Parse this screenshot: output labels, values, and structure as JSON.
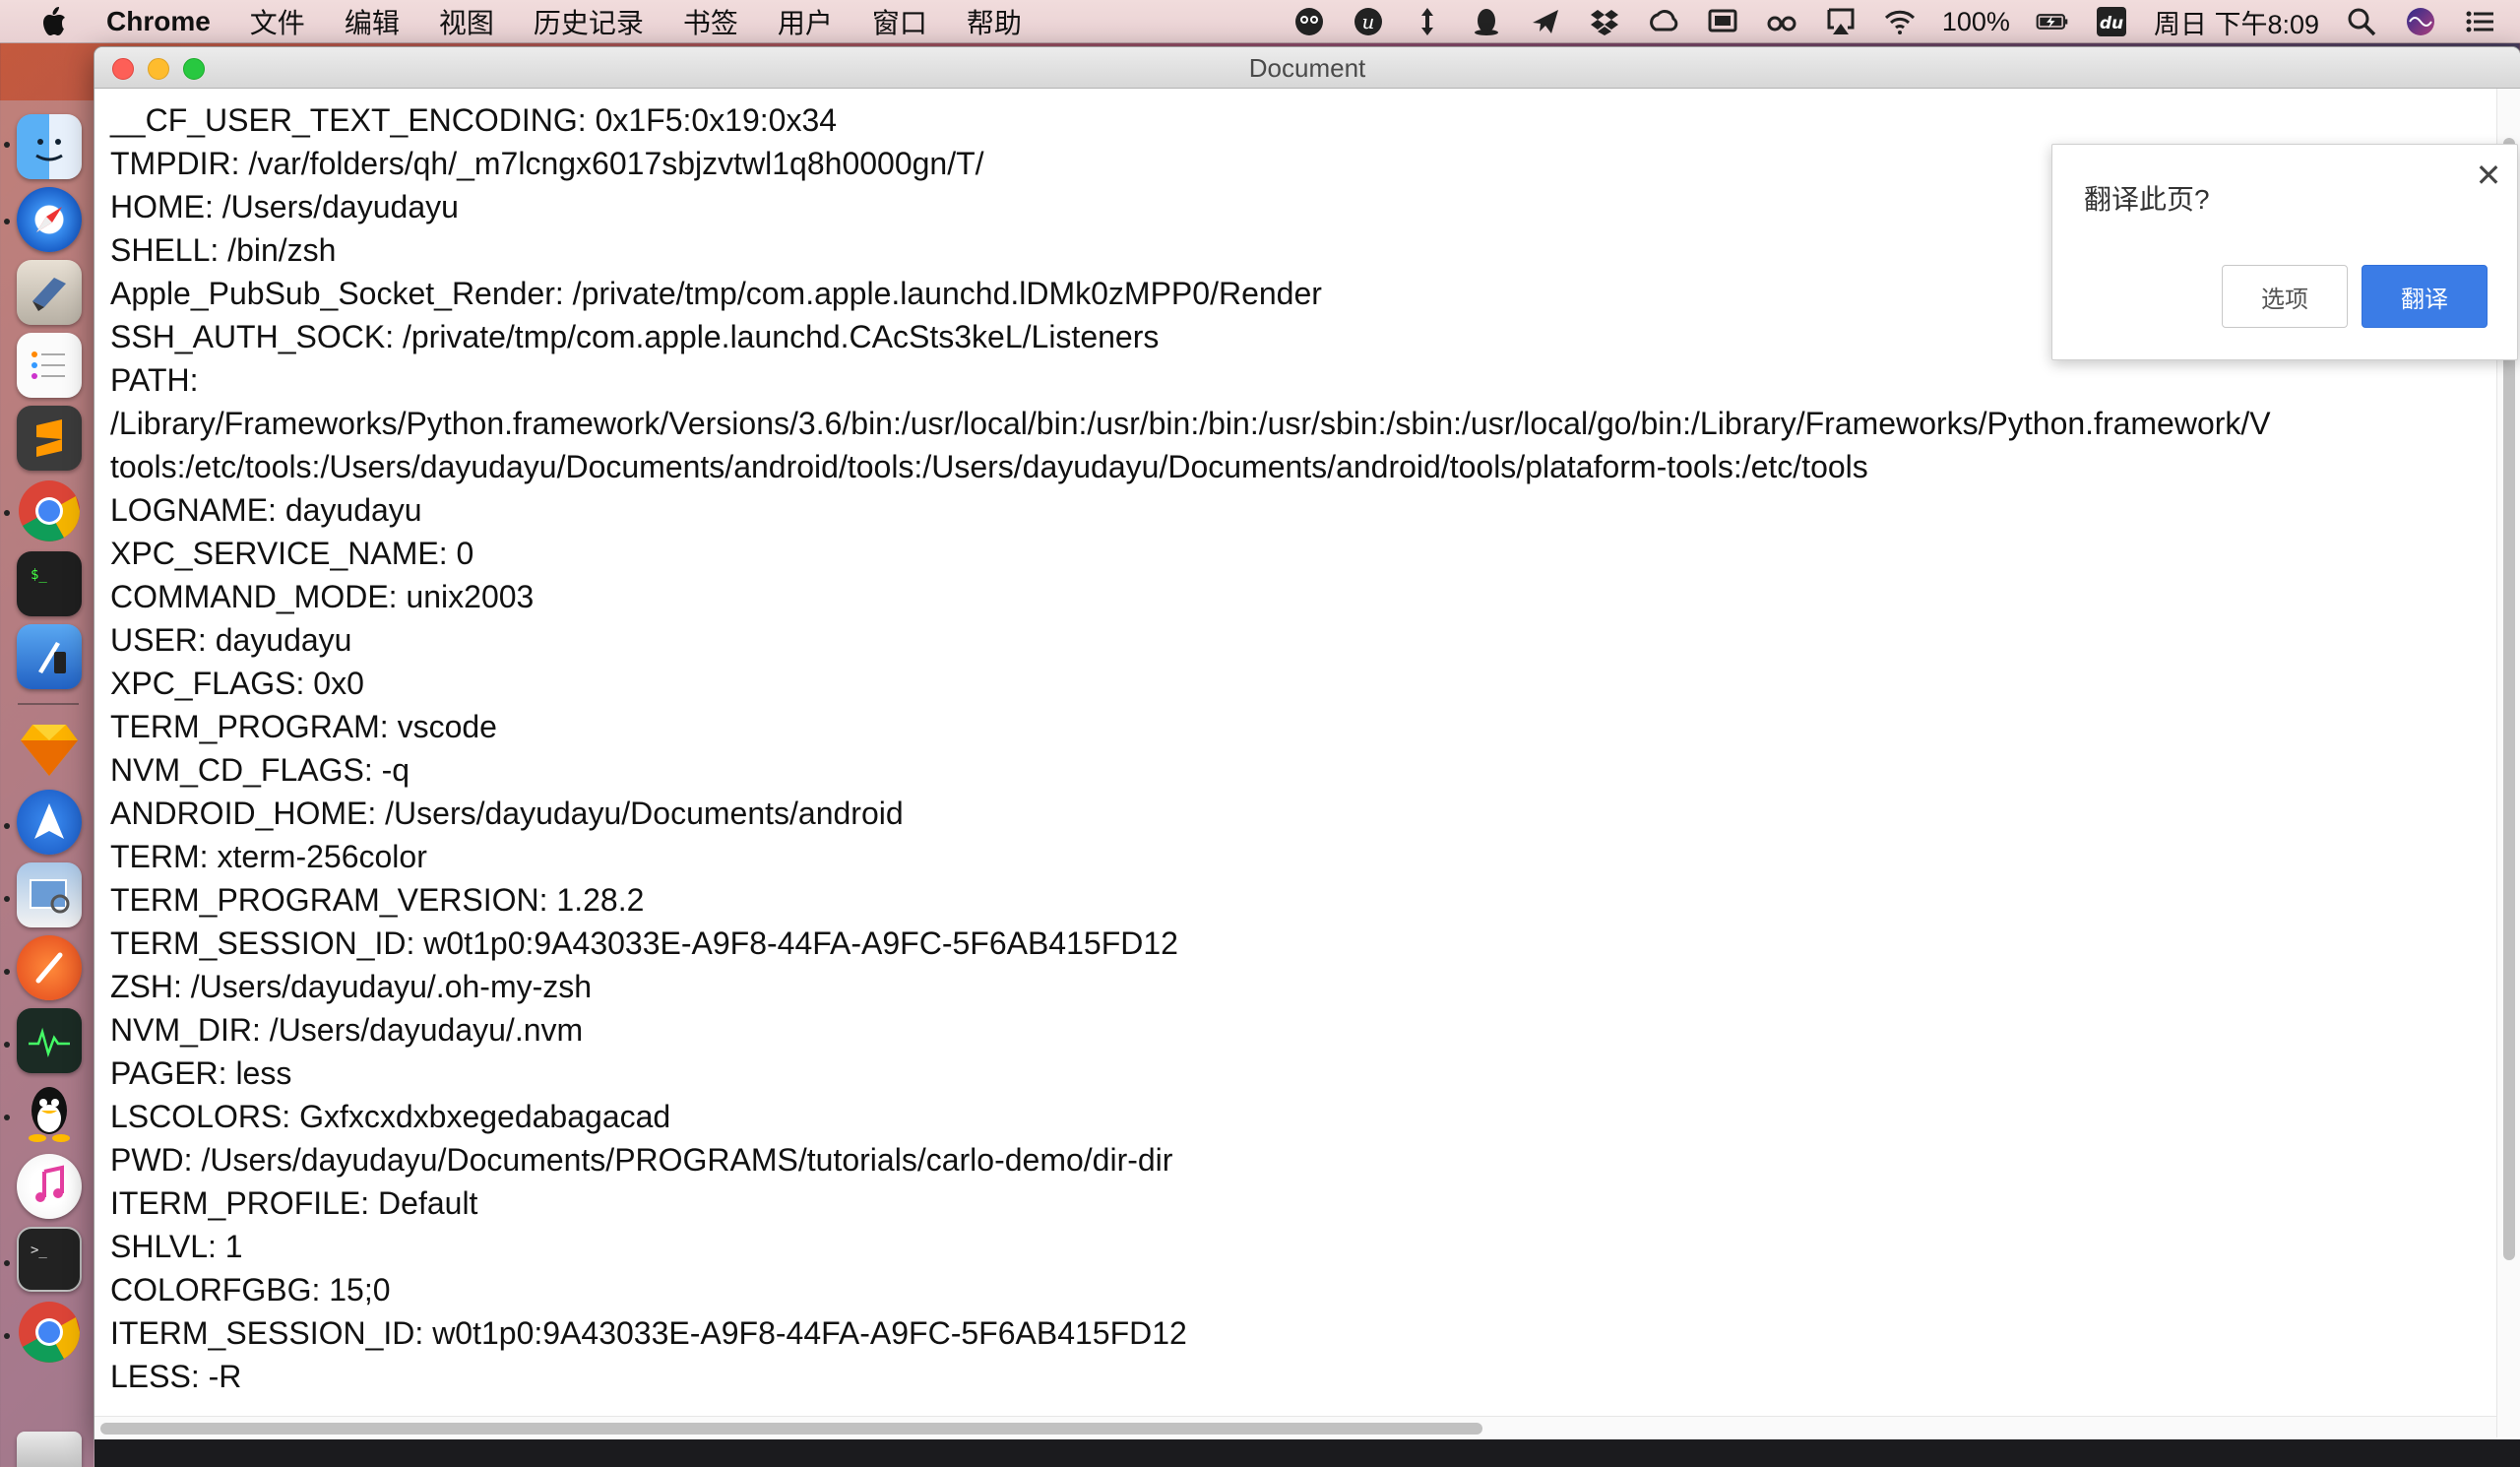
{
  "menubar": {
    "app_name": "Chrome",
    "items": [
      "文件",
      "编辑",
      "视图",
      "历史记录",
      "书签",
      "用户",
      "窗口",
      "帮助"
    ],
    "battery": "100%",
    "clock": "周日 下午8:09",
    "tray_icons": [
      "owl-icon",
      "u-icon",
      "arrows-icon",
      "qq-icon",
      "paper-plane-icon",
      "dropbox-icon",
      "creative-cloud-icon",
      "display-icon",
      "glasses-icon",
      "airplay-icon",
      "wifi-icon",
      "battery-icon",
      "du-icon",
      "search-icon",
      "siri-icon",
      "list-icon"
    ]
  },
  "window": {
    "title": "Document"
  },
  "env_lines": [
    "__CF_USER_TEXT_ENCODING: 0x1F5:0x19:0x34",
    "TMPDIR: /var/folders/qh/_m7lcngx6017sbjzvtwl1q8h0000gn/T/",
    "HOME: /Users/dayudayu",
    "SHELL: /bin/zsh",
    "Apple_PubSub_Socket_Render: /private/tmp/com.apple.launchd.lDMk0zMPP0/Render",
    "SSH_AUTH_SOCK: /private/tmp/com.apple.launchd.CAcSts3keL/Listeners",
    "PATH:",
    "/Library/Frameworks/Python.framework/Versions/3.6/bin:/usr/local/bin:/usr/bin:/bin:/usr/sbin:/sbin:/usr/local/go/bin:/Library/Frameworks/Python.framework/V",
    "tools:/etc/tools:/Users/dayudayu/Documents/android/tools:/Users/dayudayu/Documents/android/tools/plataform-tools:/etc/tools",
    "LOGNAME: dayudayu",
    "XPC_SERVICE_NAME: 0",
    "COMMAND_MODE: unix2003",
    "USER: dayudayu",
    "XPC_FLAGS: 0x0",
    "TERM_PROGRAM: vscode",
    "NVM_CD_FLAGS: -q",
    "ANDROID_HOME: /Users/dayudayu/Documents/android",
    "TERM: xterm-256color",
    "TERM_PROGRAM_VERSION: 1.28.2",
    "TERM_SESSION_ID: w0t1p0:9A43033E-A9F8-44FA-A9FC-5F6AB415FD12",
    "ZSH: /Users/dayudayu/.oh-my-zsh",
    "NVM_DIR: /Users/dayudayu/.nvm",
    "PAGER: less",
    "LSCOLORS: Gxfxcxdxbxegedabagacad",
    "PWD: /Users/dayudayu/Documents/PROGRAMS/tutorials/carlo-demo/dir-dir",
    "ITERM_PROFILE: Default",
    "SHLVL: 1",
    "COLORFGBG: 15;0",
    "ITERM_SESSION_ID: w0t1p0:9A43033E-A9F8-44FA-A9FC-5F6AB415FD12",
    "LESS: -R"
  ],
  "translate_popup": {
    "prompt": "翻译此页?",
    "options_label": "选项",
    "translate_label": "翻译",
    "close_glyph": "✕",
    "accent": "#3b7ce6"
  },
  "dock": {
    "apps": [
      "finder-icon",
      "safari-icon",
      "mail-icon",
      "reminders-icon",
      "sublime-text-icon",
      "chrome-icon",
      "terminal-icon",
      "xcode-icon",
      "sketch-icon",
      "spark-icon",
      "preview-icon",
      "paw-icon",
      "activity-monitor-icon",
      "qq-icon",
      "itunes-icon",
      "iterm-icon",
      "chrome-icon",
      "trash-icon"
    ]
  }
}
